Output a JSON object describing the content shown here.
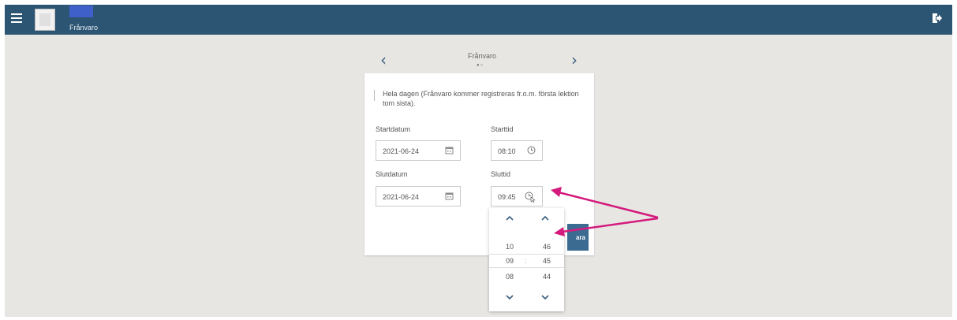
{
  "header": {
    "app_title": "Frånvaro",
    "colors": {
      "bar": "#2c5473",
      "logo": "#3f5fc9"
    },
    "icons": [
      "menu-icon",
      "avatar",
      "logout-icon"
    ]
  },
  "nav": {
    "title": "Frånvaro",
    "dots": "●○"
  },
  "form": {
    "all_day_label": "Hela dagen (Frånvaro kommer registreras fr.o.m. första lektion tom sista).",
    "start_date_label": "Startdatum",
    "start_date_value": "2021-06-24",
    "start_time_label": "Starttid",
    "start_time_value": "08:10",
    "end_date_label": "Slutdatum",
    "end_date_value": "2021-06-24",
    "end_time_label": "Sluttid",
    "end_time_value": "09:45",
    "save_partial": "ara"
  },
  "time_picker": {
    "hours": {
      "prev": "10",
      "current": "09",
      "next": "08"
    },
    "separator": ":",
    "minutes": {
      "prev": "46",
      "current": "45",
      "next": "44"
    }
  },
  "annotation": {
    "arrow_color": "#d41b7d"
  }
}
